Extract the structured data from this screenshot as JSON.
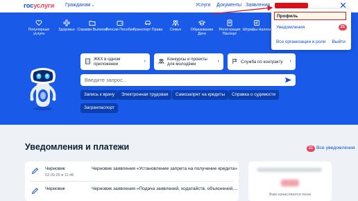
{
  "header": {
    "logo_part1": "гос",
    "logo_part2": "услуги",
    "citizen_menu": "Гражданам",
    "nav": [
      "Услуги",
      "Документы",
      "Заявления"
    ]
  },
  "categories": [
    {
      "label": "Популярные услуги",
      "icon": "heart-icon"
    },
    {
      "label": "Здоровье",
      "icon": "medical-cross-icon"
    },
    {
      "label": "Справки Выписки",
      "icon": "folder-icon"
    },
    {
      "label": "Пенсии Пособия",
      "icon": "wallet-icon"
    },
    {
      "label": "Транспорт Права",
      "icon": "car-icon"
    },
    {
      "label": "Семья",
      "icon": "family-icon"
    },
    {
      "label": "Образование Дети",
      "icon": "graduation-cap-icon"
    },
    {
      "label": "Регистрация Паспорт",
      "icon": "passport-icon"
    },
    {
      "label": "Штрафы Налоги",
      "icon": "fine-icon"
    }
  ],
  "promo_cards": [
    {
      "label": "ЖКХ в одном приложении",
      "icon": "building-icon"
    },
    {
      "label": "Конкурсы и проекты для молодёжи",
      "icon": "youth-people-icon"
    },
    {
      "label": "Служба по контракту",
      "icon": "flag-icon"
    }
  ],
  "search": {
    "placeholder": "Введите запрос..."
  },
  "quick_chips": [
    "Запись к врачу",
    "Электронная трудовая",
    "Самозапрет на кредиты",
    "Справка о судимости",
    "Загранпаспорт"
  ],
  "notifications_section": {
    "title": "Уведомления и платежи",
    "all_link": "Все уведомления",
    "count": "21",
    "items": [
      {
        "status": "Черновик",
        "date": "02.03.25 в 11:46",
        "text": "Черновик заявления «Установление запрета на получение кредита»"
      },
      {
        "status": "Черновик",
        "date": "",
        "text": "Черновик заявления «Подача заявлений, ходатайств, объяснений,..."
      }
    ]
  },
  "side_panel": {
    "caption": "Вам начисляются пени"
  },
  "dropdown": {
    "profile": "Профиль",
    "notifications": "Уведомления",
    "notifications_count": "21",
    "orgs": "Все организации и роли",
    "logout": "Выйти"
  },
  "colors": {
    "brand_blue": "#0d4cd3",
    "hero_blue": "#1a5ae8",
    "accent_red": "#ee3f58",
    "highlight_red": "#d81b2a"
  }
}
